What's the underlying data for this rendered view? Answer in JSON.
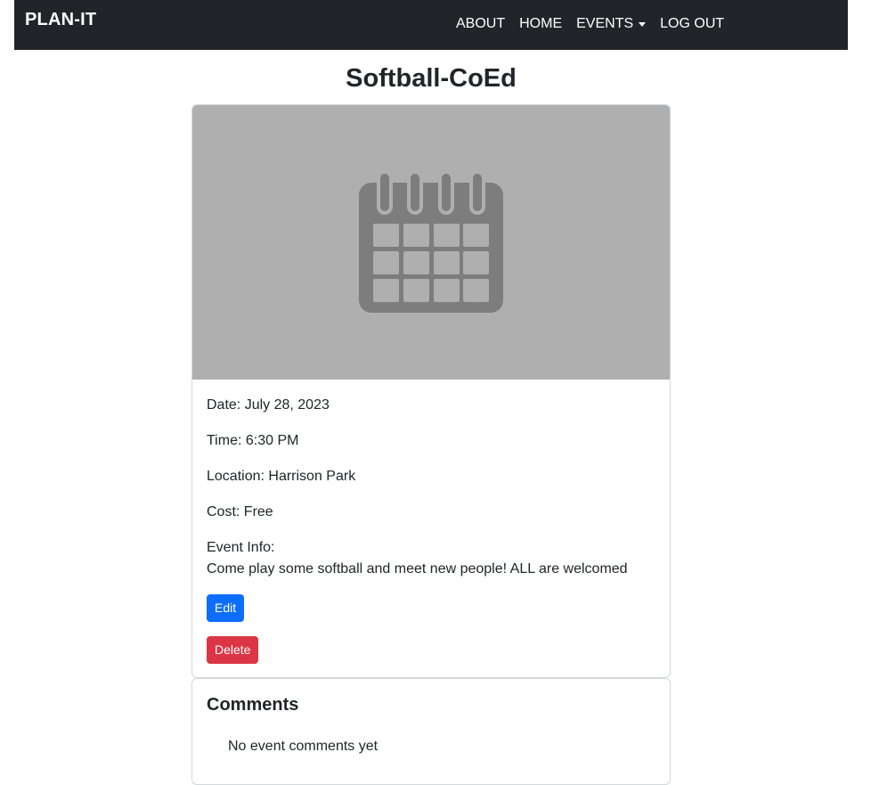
{
  "nav": {
    "brand": "PLAN-IT",
    "links": [
      "ABOUT",
      "HOME",
      "EVENTS",
      "LOG OUT"
    ]
  },
  "event": {
    "title": "Softball-CoEd",
    "image_icon": "calendar-icon",
    "date": "Date: July 28, 2023",
    "time": "Time: 6:30 PM",
    "location": "Location: Harrison Park",
    "cost": "Cost: Free",
    "info_label": "Event Info:",
    "info_text": "Come play some softball and meet new people! ALL are welcomed",
    "edit_label": "Edit",
    "delete_label": "Delete"
  },
  "comments": {
    "title": "Comments",
    "empty_text": "No event comments yet"
  },
  "colors": {
    "navbar": "#212529",
    "edit": "#0d6efd",
    "delete": "#dc3545",
    "image_bg": "#afafaf",
    "icon": "#7d7d7d"
  }
}
